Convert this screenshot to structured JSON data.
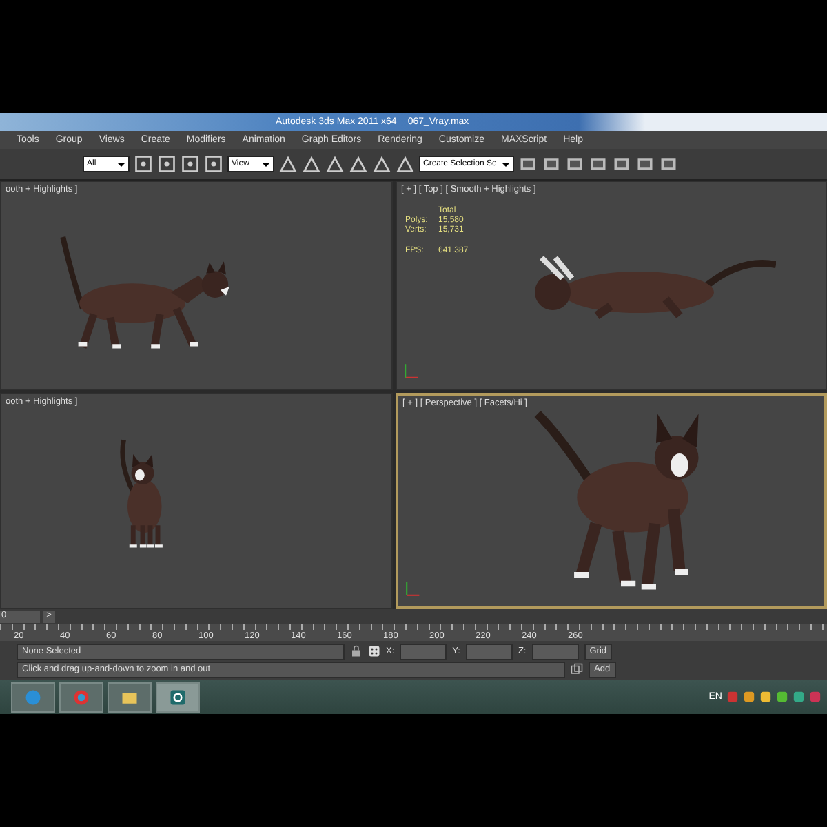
{
  "window": {
    "title": "Autodesk 3ds Max  2011 x64",
    "file": "067_Vray.max"
  },
  "menu": [
    "Tools",
    "Group",
    "Views",
    "Create",
    "Modifiers",
    "Animation",
    "Graph Editors",
    "Rendering",
    "Customize",
    "MAXScript",
    "Help"
  ],
  "toolbar": {
    "selection_filter": "All",
    "reference_coord": "View",
    "named_selection": "Create Selection Se"
  },
  "viewports": [
    {
      "label": "ooth + Highlights ]",
      "kind": "side",
      "selected": false
    },
    {
      "label": "[ + ] [ Top ] [ Smooth + Highlights ]",
      "kind": "top",
      "selected": false,
      "stats": {
        "heading": "Total",
        "rows": [
          {
            "label": "Polys:",
            "value": "15,580"
          },
          {
            "label": "Verts:",
            "value": "15,731"
          }
        ],
        "fps_label": "FPS:",
        "fps": "641.387"
      }
    },
    {
      "label": "ooth + Highlights ]",
      "kind": "front",
      "selected": false
    },
    {
      "label": "[ + ] [ Perspective ] [ Facets/Hi ]",
      "kind": "perspective",
      "selected": true
    }
  ],
  "timeline": {
    "frame": "0",
    "level": 0,
    "next": ">",
    "ticks": [
      "20",
      "40",
      "60",
      "80",
      "100",
      "120",
      "140",
      "160",
      "180",
      "200",
      "220",
      "240",
      "260"
    ]
  },
  "status": {
    "selection": "None Selected",
    "x_label": "X:",
    "y_label": "Y:",
    "z_label": "Z:",
    "grid": "Grid",
    "prompt": "Click and drag up-and-down to zoom in and out",
    "add": "Add"
  },
  "taskbar": {
    "language": "EN"
  }
}
